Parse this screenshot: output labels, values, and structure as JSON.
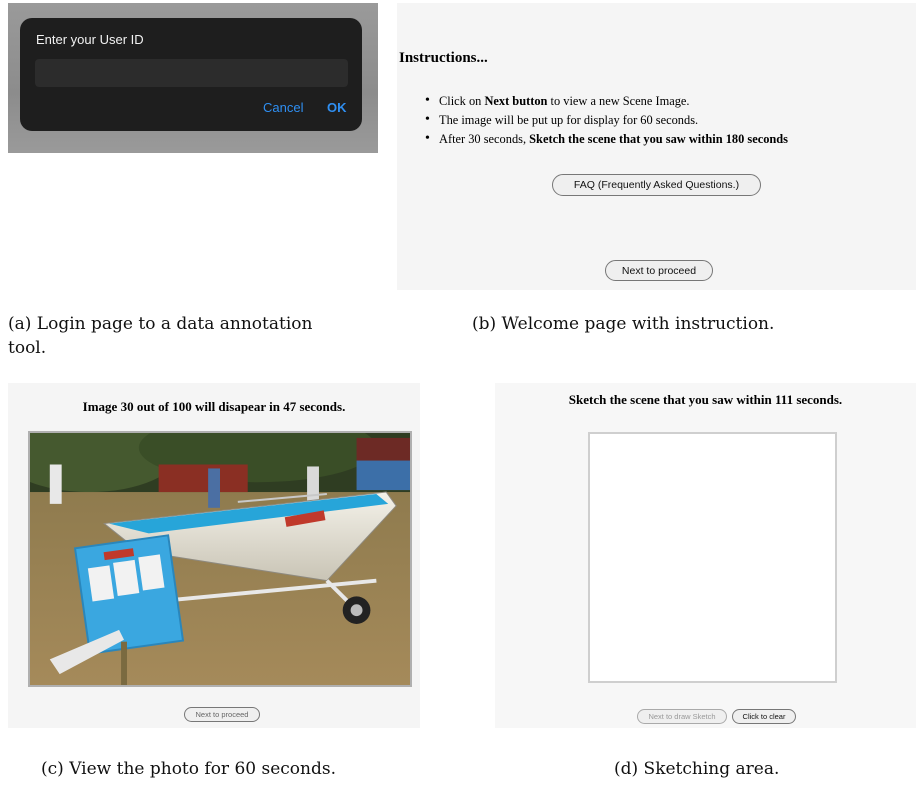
{
  "login": {
    "prompt": "Enter your User ID",
    "input_value": "",
    "cancel_label": "Cancel",
    "ok_label": "OK",
    "accent_color": "#2f8ff2"
  },
  "welcome": {
    "title": "Instructions...",
    "items": [
      {
        "pre": "Click on ",
        "bold": "Next button",
        "post": " to view a new Scene Image."
      },
      {
        "pre": "The image will be put up for display for 60 seconds.",
        "bold": "",
        "post": ""
      },
      {
        "pre": "After 30 seconds, ",
        "bold": "Sketch the scene that you saw within 180 seconds",
        "post": ""
      }
    ],
    "faq_label": "FAQ (Frequently Asked Questions.)",
    "next_label": "Next to proceed"
  },
  "photo_view": {
    "title": "Image 30 out of 100 will disapear in 47 seconds.",
    "image_alt": "boat-on-trailer-photo",
    "next_label": "Next to proceed"
  },
  "sketch_view": {
    "title": "Sketch the scene that you saw within 111 seconds.",
    "next_label": "Next to draw Sketch",
    "clear_label": "Click to clear"
  },
  "captions": {
    "a": "(a) Login page to a data annotation tool.",
    "b": "(b) Welcome page with instruction.",
    "c": "(c) View the photo for 60 seconds.",
    "d": "(d) Sketching area."
  }
}
